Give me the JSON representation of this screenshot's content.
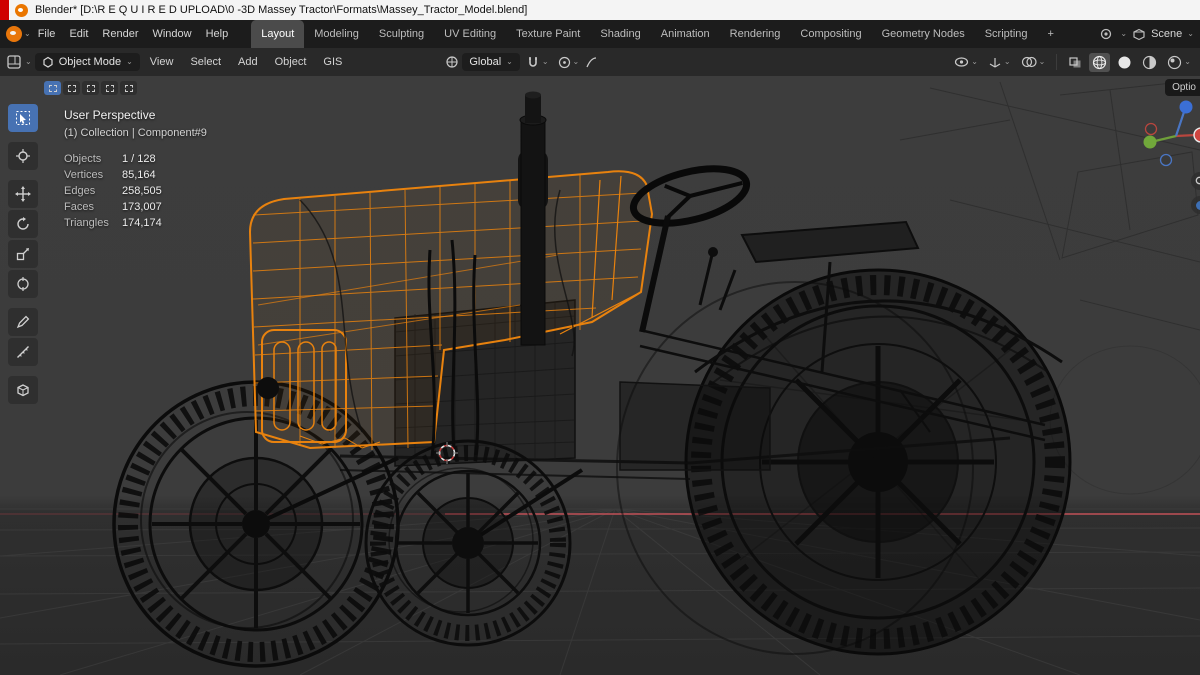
{
  "window": {
    "title": "Blender* [D:\\R E Q U I R E D   UPLOAD\\0 -3D Massey Tractor\\Formats\\Massey_Tractor_Model.blend]"
  },
  "menubar": {
    "menus": [
      "File",
      "Edit",
      "Render",
      "Window",
      "Help"
    ],
    "workspaces": [
      "Layout",
      "Modeling",
      "Sculpting",
      "UV Editing",
      "Texture Paint",
      "Shading",
      "Animation",
      "Rendering",
      "Compositing",
      "Geometry Nodes",
      "Scripting"
    ],
    "active_workspace": "Layout",
    "add_tab": "+",
    "scene_label": "Scene"
  },
  "header": {
    "mode": "Object Mode",
    "menus": [
      "View",
      "Select",
      "Add",
      "Object",
      "GIS"
    ],
    "orientation": "Global"
  },
  "viewport": {
    "view_label": "User Perspective",
    "context_label": "(1) Collection | Component#9",
    "stats": [
      {
        "label": "Objects",
        "value": "1 / 128"
      },
      {
        "label": "Vertices",
        "value": "85,164"
      },
      {
        "label": "Edges",
        "value": "258,505"
      },
      {
        "label": "Faces",
        "value": "173,007"
      },
      {
        "label": "Triangles",
        "value": "174,174"
      }
    ],
    "sidebar_tab": "Optio"
  },
  "icons": {
    "caret": "⌄"
  },
  "colors": {
    "accent": "#4772b3",
    "selection_orange": "#e8820e",
    "axis_x": "#c9535a",
    "axis_y": "#71a83b",
    "axis_z": "#3b6fd6",
    "titlebar_stripe": "#cf0000"
  }
}
